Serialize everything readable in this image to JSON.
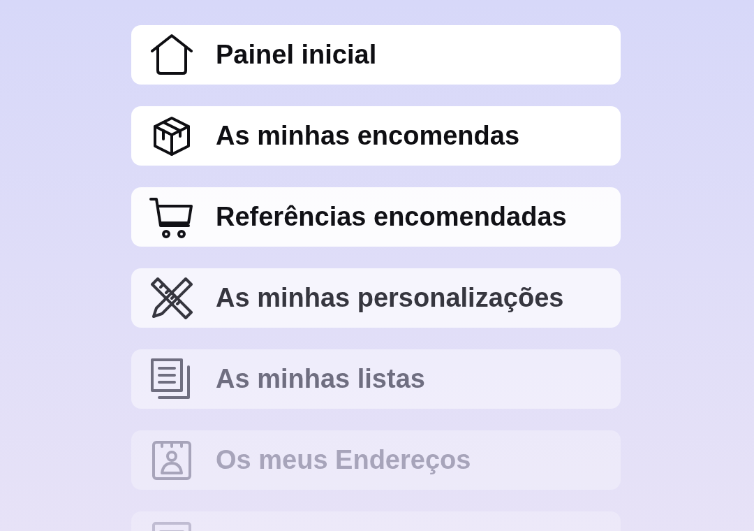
{
  "menu": {
    "items": [
      {
        "kind": "home",
        "label": "Painel inicial"
      },
      {
        "kind": "box",
        "label": "As minhas encomendas"
      },
      {
        "kind": "cart",
        "label": "Referências encomendadas"
      },
      {
        "kind": "tools",
        "label": "As minhas personalizações"
      },
      {
        "kind": "lists",
        "label": "As minhas listas"
      },
      {
        "kind": "address",
        "label": "Os meus Endereços"
      },
      {
        "kind": "form"
      }
    ]
  }
}
